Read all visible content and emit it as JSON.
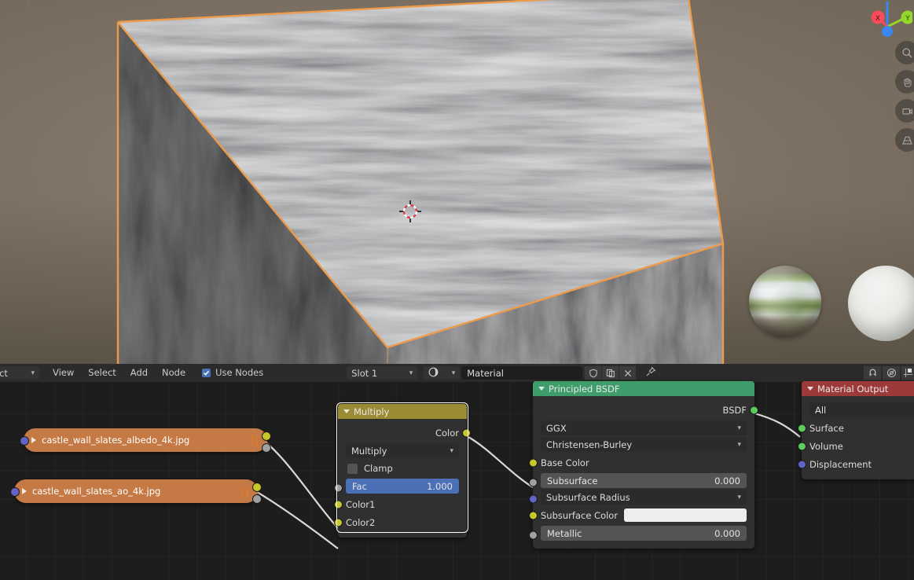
{
  "app": "Blender",
  "viewport": {
    "name": "3d-viewport",
    "gizmo": {
      "axis_x": "X",
      "axis_y": "Y",
      "axis_z": "Z",
      "color_x": "#fa4b5c",
      "color_y": "#94d62a",
      "color_z": "#3b86ef"
    },
    "tools": [
      {
        "name": "zoom-tool",
        "icon": "magnifier-icon"
      },
      {
        "name": "pan-tool",
        "icon": "hand-icon"
      },
      {
        "name": "camera-view-tool",
        "icon": "camera-icon"
      },
      {
        "name": "toggle-orthographic-tool",
        "icon": "grid-perspective-icon"
      }
    ],
    "object": {
      "name": "textured-cube",
      "selected": true,
      "outline_color": "#ed9b4b"
    },
    "preview_spheres": [
      {
        "name": "hdri-chrome-sphere"
      },
      {
        "name": "hdri-diffuse-sphere"
      }
    ],
    "cursor": {
      "name": "3d-cursor"
    }
  },
  "node_editor": {
    "header": {
      "mode_dropdown": {
        "label": "ect",
        "icon": "chevron-down-icon"
      },
      "menus": [
        "View",
        "Select",
        "Add",
        "Node"
      ],
      "use_nodes": {
        "label": "Use Nodes",
        "checked": true
      },
      "slot_dropdown": {
        "label": "Slot 1",
        "icon": "chevron-down-icon"
      },
      "material_browse": {
        "icon": "material-sphere-icon"
      },
      "material_name": "Material",
      "buttons": [
        {
          "name": "fake-user-button",
          "icon": "shield-icon"
        },
        {
          "name": "new-material-button",
          "icon": "copy-icon"
        },
        {
          "name": "unlink-material-button",
          "icon": "x-icon"
        },
        {
          "name": "pin-button",
          "icon": "pin-icon"
        }
      ],
      "right_buttons": [
        {
          "name": "snap-toggle",
          "icon": "magnet-icon"
        },
        {
          "name": "proportional-editing-toggle",
          "icon": "proportional-circle-icon"
        },
        {
          "name": "overlays-toggle",
          "icon": "overlay-icon"
        }
      ]
    },
    "nodes": [
      {
        "id": "img_albedo",
        "name": "image-texture-node-albedo",
        "title": "castle_wall_slates_albedo_4k.jpg",
        "collapsed": true,
        "header_color": "#c57a45",
        "sockets_in": [
          {
            "name": "vector-input",
            "color": "#6363c7"
          }
        ],
        "sockets_out": [
          {
            "name": "color-output",
            "color": "#c7c729"
          },
          {
            "name": "alpha-output",
            "color": "#a1a1a1"
          }
        ]
      },
      {
        "id": "img_ao",
        "name": "image-texture-node-ao",
        "title": "castle_wall_slates_ao_4k.jpg",
        "collapsed": true,
        "header_color": "#c57a45",
        "sockets_in": [
          {
            "name": "vector-input",
            "color": "#6363c7"
          }
        ],
        "sockets_out": [
          {
            "name": "color-output",
            "color": "#c7c729"
          },
          {
            "name": "alpha-output",
            "color": "#a1a1a1"
          }
        ]
      },
      {
        "id": "mix_rgb",
        "name": "mix-rgb-node",
        "title": "Multiply",
        "header_color": "#9b8b35",
        "selected": true,
        "outputs": [
          {
            "label": "Color",
            "socket": "#c7c729"
          }
        ],
        "blend_mode": "Multiply",
        "clamp": {
          "label": "Clamp",
          "checked": false
        },
        "fac": {
          "label": "Fac",
          "value": "1.000"
        },
        "inputs": [
          {
            "label": "Color1",
            "socket": "#c7c729"
          },
          {
            "label": "Color2",
            "socket": "#c7c729"
          }
        ]
      },
      {
        "id": "principled",
        "name": "principled-bsdf-node",
        "title": "Principled BSDF",
        "header_color": "#3f9d6b",
        "outputs": [
          {
            "label": "BSDF",
            "socket": "#5ccc5c"
          }
        ],
        "distribution": "GGX",
        "subsurface_method": "Christensen-Burley",
        "inputs": [
          {
            "label": "Base Color",
            "socket": "#c7c729",
            "kind": "label"
          },
          {
            "label": "Subsurface",
            "socket": "#a1a1a1",
            "kind": "value",
            "value": "0.000"
          },
          {
            "label": "Subsurface Radius",
            "socket": "#6363c7",
            "kind": "select"
          },
          {
            "label": "Subsurface Color",
            "socket": "#c7c729",
            "kind": "swatch",
            "color": "#eeeeee"
          },
          {
            "label": "Metallic",
            "socket": "#a1a1a1",
            "kind": "value",
            "value": "0.000"
          }
        ]
      },
      {
        "id": "output",
        "name": "material-output-node",
        "title": "Material Output",
        "header_color": "#9c3a3a",
        "target": "All",
        "inputs": [
          {
            "label": "Surface",
            "socket": "#5ccc5c"
          },
          {
            "label": "Volume",
            "socket": "#5ccc5c"
          },
          {
            "label": "Displacement",
            "socket": "#6363c7"
          }
        ]
      }
    ]
  }
}
